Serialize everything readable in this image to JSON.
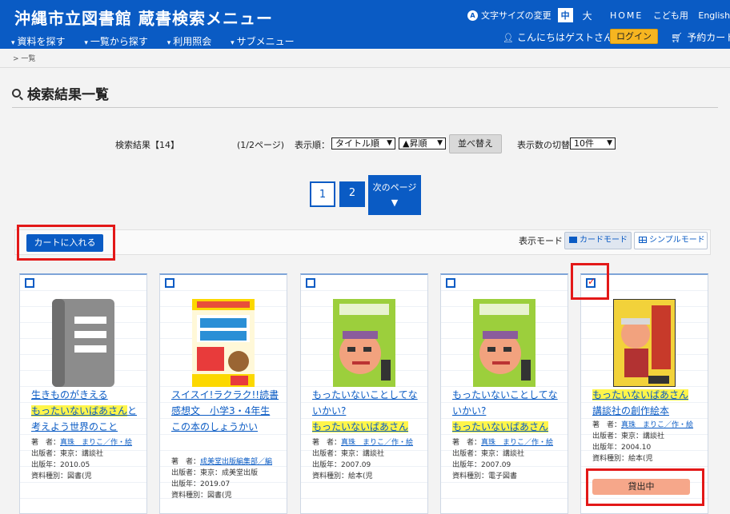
{
  "header": {
    "title": "沖縄市立図書館 蔵書検索メニュー",
    "font_size_label": "文字サイズの変更",
    "font_size_medium": "中",
    "font_size_large": "大",
    "links": [
      "HOME",
      "こども用",
      "English"
    ],
    "nav": [
      "資料を探す",
      "一覧から探す",
      "利用照会",
      "サブメニュー"
    ],
    "greeting": "こんにちはゲストさん",
    "login": "ログイン",
    "cart": "予約カート"
  },
  "breadcrumb": "> 一覧",
  "page_title": "検索結果一覧",
  "results": {
    "count": "検索結果【14】",
    "page_info": "(1/2ページ)",
    "order_label": "表示順：",
    "order_select": "タイトル順",
    "direction_select": "▲昇順",
    "sort_button": "並べ替え",
    "per_page_label": "表示数の切替",
    "per_page_select": "10件"
  },
  "pagination": {
    "current": "1",
    "page2": "2",
    "next": "次のページ"
  },
  "cart_button": "カートに入れる",
  "mode_label": "表示モード",
  "mode_card": "カードモード",
  "mode_simple": "シンプルモード",
  "colors": {
    "brand": "#0a5bc4",
    "highlight": "#fff54a",
    "lent": "#f6a78a",
    "annotation": "#e31818"
  },
  "cards": [
    {
      "checked": false,
      "cover": "placeholder-book-icon",
      "title_main": "生きものがきえる",
      "title_hl": "もったいないばあさん",
      "title_rest": "と考えよう世界のこと",
      "author_label": "著　者：",
      "author": "真珠　まりこ／作・絵",
      "publisher": "出版者：東京：講談社",
      "year": "出版年：2010.05",
      "type": "資料種別：図書(児"
    },
    {
      "checked": false,
      "cover": "book-cover-dokusho",
      "title_main": "スイスイ!ラクラク!!読書感想文　小学3・4年生",
      "title_sub": "この本のしょうかい",
      "author_label": "著　者：",
      "author": "成美堂出版編集部／編",
      "publisher": "出版者：東京：成美堂出版",
      "year": "出版年：2019.07",
      "type": "資料種別：図書(児"
    },
    {
      "checked": false,
      "cover": "book-cover-mottainai",
      "title_main": "もったいないことしてないかい?",
      "title_hl": "もったいないばあさん",
      "author_label": "著　者：",
      "author": "真珠　まりこ／作・絵",
      "publisher": "出版者：東京：講談社",
      "year": "出版年：2007.09",
      "type": "資料種別：絵本(児"
    },
    {
      "checked": false,
      "cover": "book-cover-mottainai",
      "title_main": "もったいないことしてないかい?",
      "title_hl": "もったいないばあさん",
      "author_label": "著　者：",
      "author": "真珠　まりこ／作・絵",
      "publisher": "出版者：東京：講談社",
      "year": "出版年：2007.09",
      "type": "資料種別：電子図書"
    },
    {
      "checked": true,
      "cover": "book-cover-baasan",
      "title_hl": "もったいないばあさん",
      "title_sub": "講談社の創作絵本",
      "author_label": "著　者：",
      "author": "真珠　まりこ／作・絵",
      "publisher": "出版者：東京：講談社",
      "year": "出版年：2004.10",
      "type": "資料種別：絵本(児",
      "status": "貸出中"
    }
  ]
}
